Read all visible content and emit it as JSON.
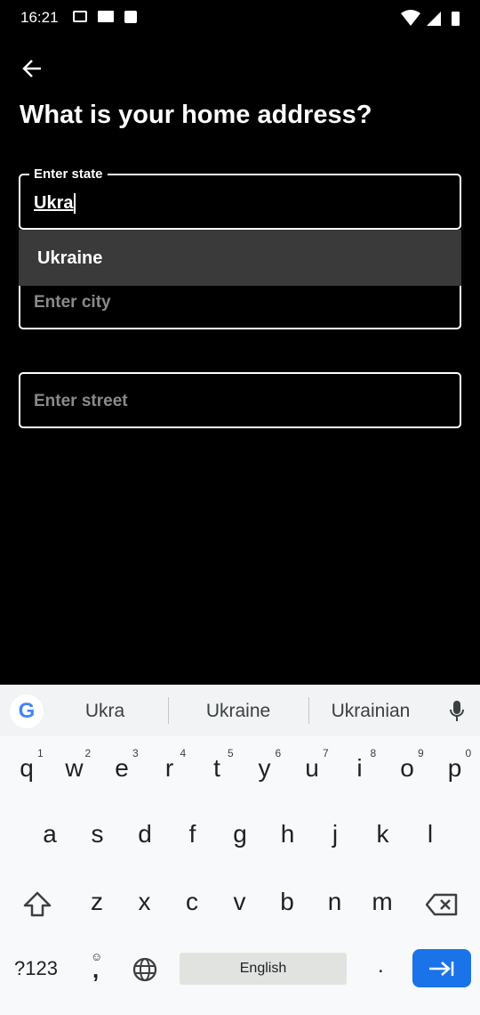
{
  "status_bar": {
    "time": "16:21",
    "icons": [
      "gmail-icon",
      "mail-icon",
      "image-icon",
      "wifi-icon",
      "signal-icon",
      "battery-charging-icon"
    ]
  },
  "header": {
    "back_icon": "arrow-left-icon",
    "title": "What is your home address?"
  },
  "form": {
    "state": {
      "label": "Enter state",
      "value": "Ukra"
    },
    "dropdown": {
      "options": [
        "Ukraine"
      ]
    },
    "city": {
      "placeholder": "Enter city"
    },
    "street": {
      "placeholder": "Enter street"
    }
  },
  "keyboard": {
    "suggestions": [
      "Ukra",
      "Ukraine",
      "Ukrainian"
    ],
    "rows": [
      [
        "q",
        "w",
        "e",
        "r",
        "t",
        "y",
        "u",
        "i",
        "o",
        "p"
      ],
      [
        "a",
        "s",
        "d",
        "f",
        "g",
        "h",
        "j",
        "k",
        "l"
      ],
      [
        "z",
        "x",
        "c",
        "v",
        "b",
        "n",
        "m"
      ]
    ],
    "hints": [
      "1",
      "2",
      "3",
      "4",
      "5",
      "6",
      "7",
      "8",
      "9",
      "0"
    ],
    "symbols_label": "?123",
    "comma": ",",
    "space_label": "English",
    "period": ".",
    "accent_color": "#1a73e8"
  }
}
